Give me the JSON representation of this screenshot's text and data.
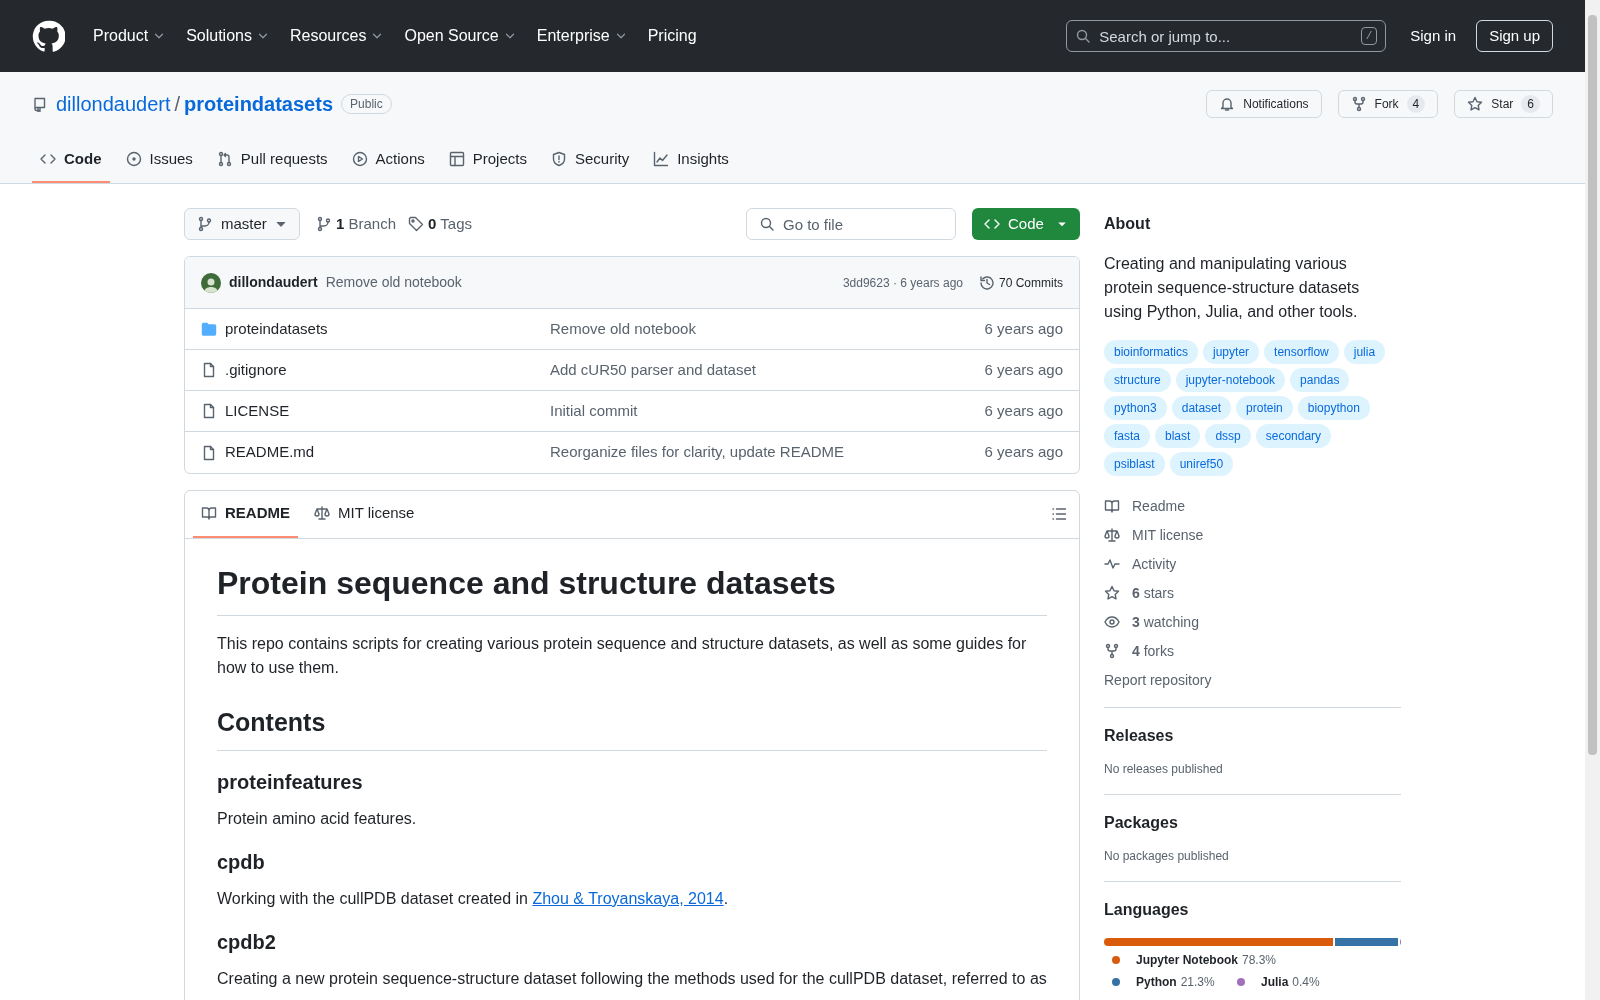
{
  "header": {
    "nav": [
      {
        "label": "Product",
        "dropdown": true
      },
      {
        "label": "Solutions",
        "dropdown": true
      },
      {
        "label": "Resources",
        "dropdown": true
      },
      {
        "label": "Open Source",
        "dropdown": true
      },
      {
        "label": "Enterprise",
        "dropdown": true
      },
      {
        "label": "Pricing",
        "dropdown": false
      }
    ],
    "search_placeholder": "Search or jump to...",
    "search_key": "/",
    "sign_in": "Sign in",
    "sign_up": "Sign up"
  },
  "repo": {
    "owner": "dillondaudert",
    "separator": "/",
    "name": "proteindatasets",
    "visibility": "Public",
    "actions": [
      {
        "kind": "notifications",
        "label": "Notifications"
      },
      {
        "kind": "fork",
        "label": "Fork",
        "count": "4"
      },
      {
        "kind": "star",
        "label": "Star",
        "count": "6"
      }
    ]
  },
  "tabs": [
    {
      "label": "Code",
      "selected": true
    },
    {
      "label": "Issues",
      "selected": false
    },
    {
      "label": "Pull requests",
      "selected": false
    },
    {
      "label": "Actions",
      "selected": false
    },
    {
      "label": "Projects",
      "selected": false
    },
    {
      "label": "Security",
      "selected": false
    },
    {
      "label": "Insights",
      "selected": false
    }
  ],
  "toolbar": {
    "branch": "master",
    "branch_count": "1",
    "branch_label": "Branch",
    "tag_count": "0",
    "tag_label": "Tags",
    "go_to_file_placeholder": "Go to file",
    "code_button": "Code"
  },
  "latest_commit": {
    "author": "dillondaudert",
    "message": "Remove old notebook",
    "hash_time": "3dd9623 · 6 years ago",
    "commits": "70 Commits"
  },
  "files": [
    {
      "kind": "folder",
      "name": "proteindatasets",
      "message": "Remove old notebook",
      "time": "6 years ago"
    },
    {
      "kind": "file",
      "name": ".gitignore",
      "message": "Add cUR50 parser and dataset",
      "time": "6 years ago"
    },
    {
      "kind": "file",
      "name": "LICENSE",
      "message": "Initial commit",
      "time": "6 years ago"
    },
    {
      "kind": "file",
      "name": "README.md",
      "message": "Reorganize files for clarity, update README",
      "time": "6 years ago"
    }
  ],
  "readme_tabs": [
    {
      "label": "README",
      "selected": true
    },
    {
      "label": "MIT license",
      "selected": false
    }
  ],
  "readme": [
    {
      "kind": "h1",
      "text": "Protein sequence and structure datasets"
    },
    {
      "kind": "p",
      "text": "This repo contains scripts for creating various protein sequence and structure datasets, as well as some guides for how to use them."
    },
    {
      "kind": "h2",
      "text": "Contents"
    },
    {
      "kind": "h3",
      "text": "proteinfeatures"
    },
    {
      "kind": "p",
      "text": "Protein amino acid features."
    },
    {
      "kind": "h3",
      "text": "cpdb"
    },
    {
      "kind": "p",
      "text": "Working with the cullPDB dataset created in ",
      "link": "Zhou & Troyanskaya, 2014",
      "after": "."
    },
    {
      "kind": "h3",
      "text": "cpdb2"
    },
    {
      "kind": "p",
      "text": "Creating a new protein sequence-structure dataset following the methods used for the cullPDB dataset, referred to as"
    }
  ],
  "sidebar": {
    "about_title": "About",
    "description": "Creating and manipulating various protein sequence-structure datasets using Python, Julia, and other tools.",
    "topics": [
      "bioinformatics",
      "jupyter",
      "tensorflow",
      "julia",
      "structure",
      "jupyter-notebook",
      "pandas",
      "python3",
      "dataset",
      "protein",
      "biopython",
      "fasta",
      "blast",
      "dssp",
      "secondary",
      "psiblast",
      "uniref50"
    ],
    "links": [
      {
        "label": "Readme"
      },
      {
        "label": "MIT license"
      },
      {
        "label": "Activity"
      },
      {
        "count": "6",
        "label": "stars"
      },
      {
        "count": "3",
        "label": "watching"
      },
      {
        "count": "4",
        "label": "forks"
      }
    ],
    "report": "Report repository",
    "releases": {
      "title": "Releases",
      "text": "No releases published"
    },
    "packages": {
      "title": "Packages",
      "text": "No packages published"
    },
    "languages": {
      "title": "Languages",
      "items": [
        {
          "name": "Jupyter Notebook",
          "percent": "78.3%",
          "level": 0.783,
          "color": "#da5b0b"
        },
        {
          "name": "Python",
          "percent": "21.3%",
          "level": 0.213,
          "color": "#3572a5"
        },
        {
          "name": "Julia",
          "percent": "0.4%",
          "level": 0.004,
          "color": "#a270ba"
        }
      ]
    }
  }
}
